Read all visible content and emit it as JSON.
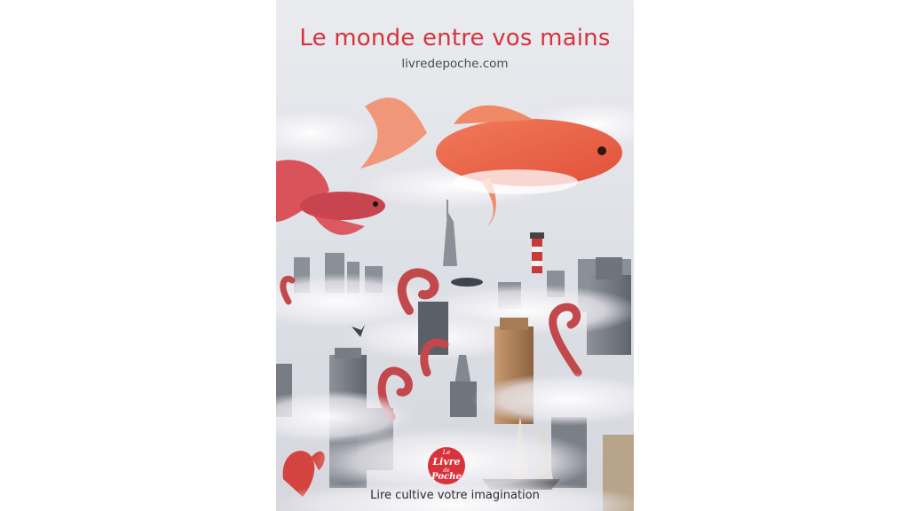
{
  "poster": {
    "headline": "Le monde entre vos mains",
    "website": "livredepoche.com",
    "tagline": "Lire cultive votre imagination",
    "logo": {
      "line1": "Le",
      "line2": "Livre",
      "line3": "de",
      "line4": "Poche",
      "color": "#d8333b"
    }
  },
  "colors": {
    "accent": "#d8333b",
    "background": "#ffffff",
    "sky": "#e3e5ea"
  }
}
